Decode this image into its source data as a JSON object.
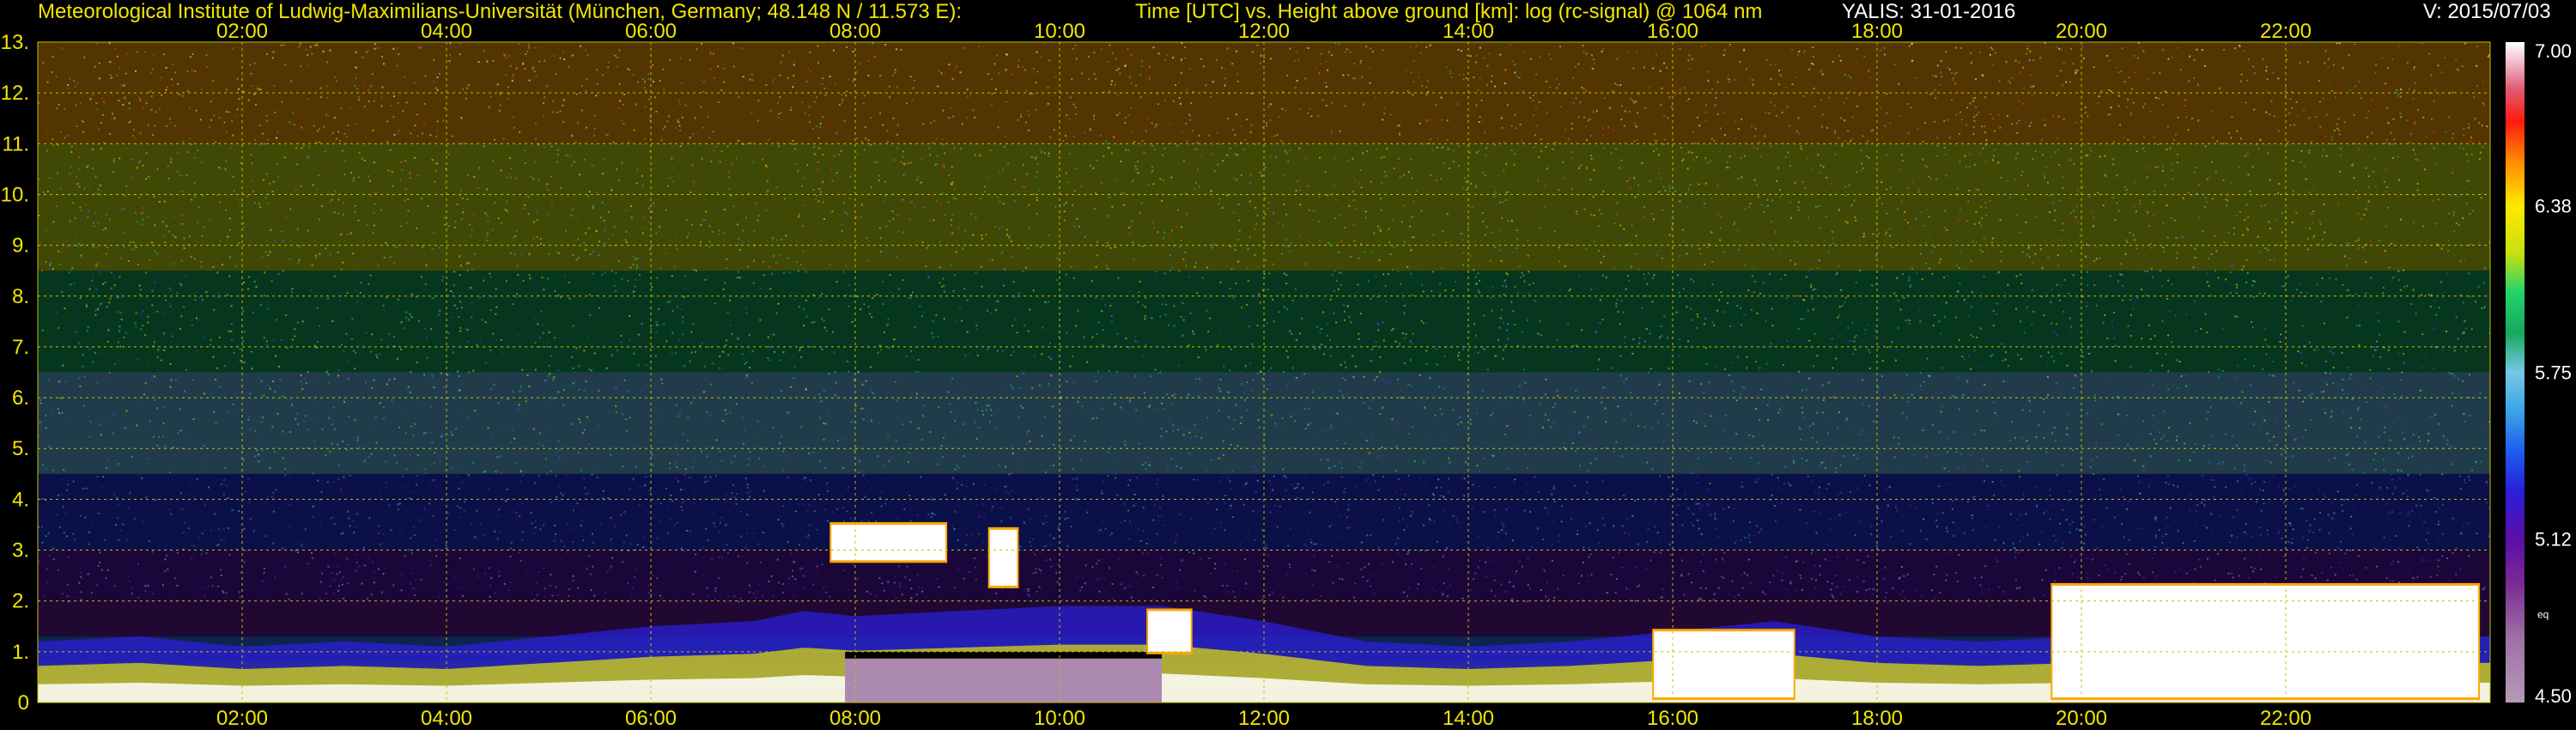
{
  "header": {
    "institute": "Meteorological Institute of Ludwig-Maximilians-Universität (München, Germany; 48.148 N / 11.573 E):",
    "plot_desc": "Time [UTC] vs. Height above ground [km]: log (rc-signal) @ 1064 nm",
    "instrument_date": "YALIS: 31-01-2016",
    "version": "V: 2015/07/03"
  },
  "colors": {
    "text_yellow": "#f2e600",
    "grid_yellow": "#c8c000",
    "background": "#000000"
  },
  "chart_data": {
    "type": "heatmap",
    "title": "Time [UTC] vs. Height above ground [km]: log (rc-signal) @ 1064 nm",
    "x_ticks": [
      "02:00",
      "04:00",
      "06:00",
      "08:00",
      "10:00",
      "12:00",
      "14:00",
      "16:00",
      "18:00",
      "20:00",
      "22:00"
    ],
    "xlim_hours": [
      0,
      24
    ],
    "y_ticks": [
      "0",
      "1.",
      "2.",
      "3.",
      "4.",
      "5.",
      "6.",
      "7.",
      "8.",
      "9.",
      "10.",
      "11.",
      "12.",
      "13."
    ],
    "ylim_km": [
      0,
      13
    ],
    "grid": true,
    "colorbar": {
      "range": [
        4.5,
        7.0
      ],
      "tick_labels": [
        "7.00",
        "6.38",
        "5.75",
        "5.12",
        "4.50"
      ],
      "tick_values": [
        7.0,
        6.38,
        5.75,
        5.12,
        4.5
      ],
      "small_label": "eq",
      "stops": [
        {
          "v": 4.5,
          "c": "#b79ab6"
        },
        {
          "v": 4.75,
          "c": "#9c70a6"
        },
        {
          "v": 4.95,
          "c": "#7b2a95"
        },
        {
          "v": 5.12,
          "c": "#5b0fa8"
        },
        {
          "v": 5.3,
          "c": "#2a1fd8"
        },
        {
          "v": 5.45,
          "c": "#1e5cf0"
        },
        {
          "v": 5.6,
          "c": "#3ba3e6"
        },
        {
          "v": 5.75,
          "c": "#78c7e6"
        },
        {
          "v": 5.9,
          "c": "#17a85c"
        },
        {
          "v": 6.05,
          "c": "#22d36a"
        },
        {
          "v": 6.2,
          "c": "#c8e010"
        },
        {
          "v": 6.38,
          "c": "#ffe800"
        },
        {
          "v": 6.55,
          "c": "#ff8a00"
        },
        {
          "v": 6.7,
          "c": "#ff1a10"
        },
        {
          "v": 6.82,
          "c": "#e05a70"
        },
        {
          "v": 6.92,
          "c": "#eeb8c8"
        },
        {
          "v": 7.0,
          "c": "#ffffff"
        }
      ]
    },
    "features": {
      "boundary_layer_top_km": [
        [
          0.0,
          1.2
        ],
        [
          1.0,
          1.3
        ],
        [
          2.0,
          1.1
        ],
        [
          3.0,
          1.2
        ],
        [
          4.0,
          1.1
        ],
        [
          5.0,
          1.3
        ],
        [
          6.0,
          1.5
        ],
        [
          7.0,
          1.6
        ],
        [
          7.5,
          1.8
        ],
        [
          8.0,
          1.7
        ],
        [
          9.0,
          1.8
        ],
        [
          10.0,
          1.9
        ],
        [
          11.0,
          1.9
        ],
        [
          12.0,
          1.6
        ],
        [
          13.0,
          1.2
        ],
        [
          14.0,
          1.1
        ],
        [
          15.0,
          1.2
        ],
        [
          16.0,
          1.4
        ],
        [
          17.0,
          1.6
        ],
        [
          18.0,
          1.3
        ],
        [
          19.0,
          1.2
        ],
        [
          20.0,
          1.3
        ],
        [
          21.0,
          1.4
        ],
        [
          22.0,
          1.3
        ],
        [
          23.0,
          1.3
        ],
        [
          24.0,
          1.3
        ]
      ],
      "cloud_layers": [
        {
          "start_h": 7.75,
          "end_h": 8.9,
          "base_km": 2.8,
          "top_km": 3.5
        },
        {
          "start_h": 9.3,
          "end_h": 9.6,
          "base_km": 2.3,
          "top_km": 3.4
        },
        {
          "start_h": 10.85,
          "end_h": 11.3,
          "base_km": 1.0,
          "top_km": 1.8
        },
        {
          "start_h": 15.8,
          "end_h": 17.2,
          "base_km": 0.1,
          "top_km": 1.4
        },
        {
          "start_h": 19.7,
          "end_h": 23.9,
          "base_km": 0.1,
          "top_km": 2.3
        }
      ],
      "attenuated_region": {
        "start_h": 7.9,
        "end_h": 11.0,
        "top_km": 0.9
      }
    }
  }
}
